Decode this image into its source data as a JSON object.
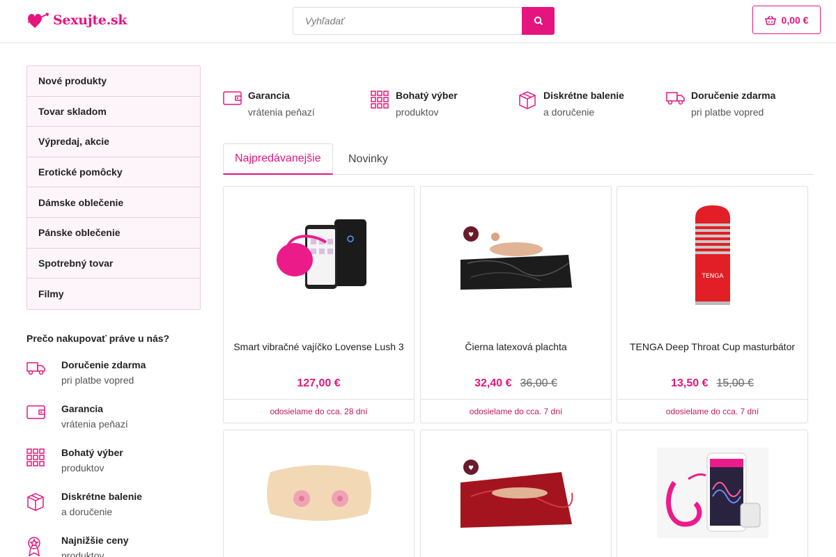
{
  "header": {
    "logo_text": "Sexujte.sk",
    "search_placeholder": "Vyhľadať",
    "cart_total": "0,00 €"
  },
  "menu": {
    "items": [
      {
        "label": "Nové produkty"
      },
      {
        "label": "Tovar skladom"
      },
      {
        "label": "Výpredaj, akcie"
      },
      {
        "label": "Erotické pomôcky"
      },
      {
        "label": "Dámske oblečenie"
      },
      {
        "label": "Pánske oblečenie"
      },
      {
        "label": "Spotrebný tovar"
      },
      {
        "label": "Filmy"
      }
    ]
  },
  "why": {
    "title": "Prečo nakupovať práve u nás?",
    "items": [
      {
        "icon": "truck-icon",
        "title": "Doručenie zdarma",
        "subtitle": "pri platbe vopred"
      },
      {
        "icon": "wallet-icon",
        "title": "Garancia",
        "subtitle": "vrátenia peňazí"
      },
      {
        "icon": "grid-icon",
        "title": "Bohatý výber",
        "subtitle": "produktov"
      },
      {
        "icon": "box-icon",
        "title": "Diskrétne balenie",
        "subtitle": "a doručenie"
      },
      {
        "icon": "badge-icon",
        "title": "Najnižšie ceny",
        "subtitle": "produktov"
      }
    ]
  },
  "features": [
    {
      "icon": "wallet-icon",
      "title": "Garancia",
      "subtitle": "vrátenia peňazí"
    },
    {
      "icon": "grid-icon",
      "title": "Bohatý výber",
      "subtitle": "produktov"
    },
    {
      "icon": "box-icon",
      "title": "Diskrétne balenie",
      "subtitle": "a doručenie"
    },
    {
      "icon": "truck-icon",
      "title": "Doručenie zdarma",
      "subtitle": "pri platbe vopred"
    }
  ],
  "tabs": [
    {
      "label": "Najpredávanejšie",
      "active": true
    },
    {
      "label": "Novinky",
      "active": false
    }
  ],
  "products": [
    {
      "name": "Smart vibračné vajíčko Lovense Lush 3",
      "price": "127,00 €",
      "old_price": "",
      "shipping": "odosielame do cca. 28 dní"
    },
    {
      "name": "Čierna latexová plachta",
      "price": "32,40 €",
      "old_price": "36,00 €",
      "shipping": "odosielame do cca. 7 dní"
    },
    {
      "name": "TENGA Deep Throat Cup masturbátor",
      "price": "13,50 €",
      "old_price": "15,00 €",
      "shipping": "odosielame do cca. 7 dní"
    },
    {
      "name": "",
      "price": "",
      "old_price": "",
      "shipping": ""
    },
    {
      "name": "",
      "price": "",
      "old_price": "",
      "shipping": ""
    },
    {
      "name": "",
      "price": "",
      "old_price": "",
      "shipping": ""
    }
  ],
  "colors": {
    "accent": "#e5157f"
  }
}
